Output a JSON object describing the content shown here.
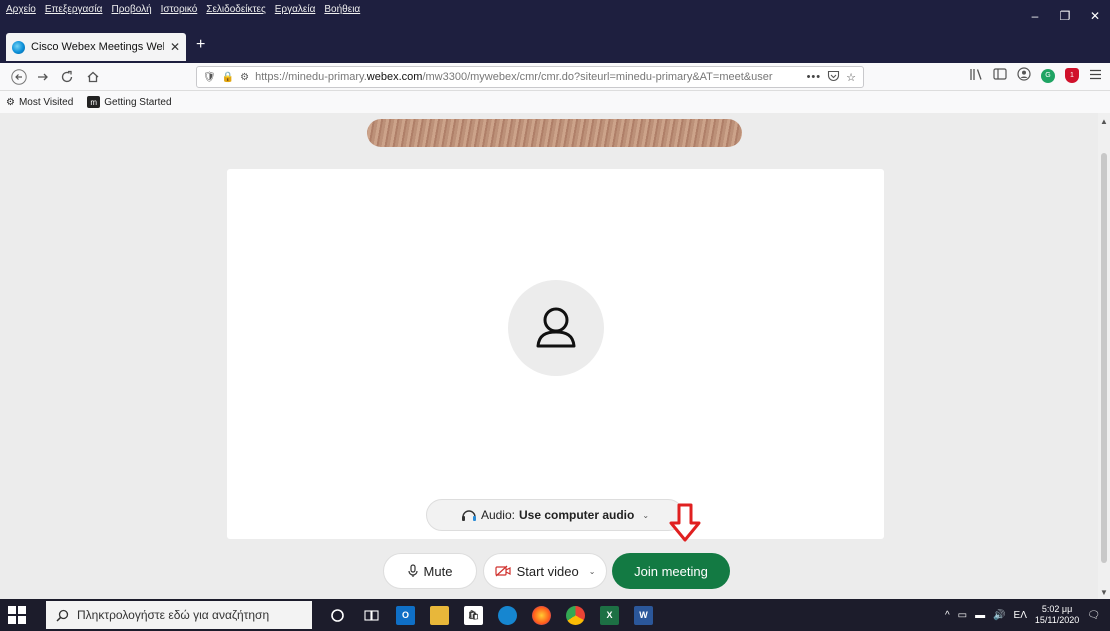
{
  "menu": [
    "Αρχείο",
    "Επεξεργασία",
    "Προβολή",
    "Ιστορικό",
    "Σελιδοδείκτες",
    "Εργαλεία",
    "Βοήθεια"
  ],
  "window_controls": {
    "minimize": "–",
    "maximize": "❐",
    "close": "✕"
  },
  "tab": {
    "title": "Cisco Webex Meetings Web Ap",
    "close": "✕",
    "new_tab": "+"
  },
  "nav": {
    "url_prefix": "https://minedu-primary.",
    "url_domain": "webex.com",
    "url_rest": "/mw3300/mywebex/cmr/cmr.do?siteurl=minedu-primary&AT=meet&user",
    "url_more": "•••"
  },
  "bookmarks": {
    "most_visited": "Most Visited",
    "getting_started": "Getting Started",
    "getting_started_icon": "m"
  },
  "meeting": {
    "audio_label": "Audio:",
    "audio_value": "Use computer audio",
    "mute_label": "Mute",
    "video_label": "Start video",
    "join_label": "Join meeting",
    "join_color": "#137a43"
  },
  "taskbar": {
    "search_placeholder": "Πληκτρολογήστε εδώ για αναζήτηση",
    "language": "ΕΛ",
    "time": "5:02 μμ",
    "date": "15/11/2020"
  }
}
